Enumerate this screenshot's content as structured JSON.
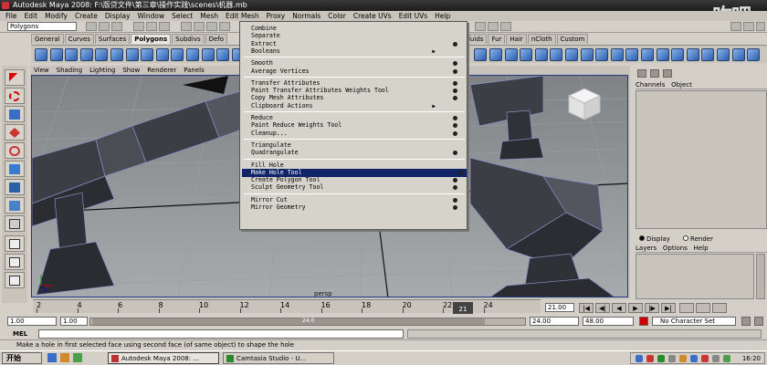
{
  "window": {
    "title": "Autodesk Maya 2008: F:\\版贷文件\\第三章\\操作实践\\scenes\\机器.mb",
    "watermark": "咋吧"
  },
  "menubar": [
    "File",
    "Edit",
    "Modify",
    "Create",
    "Display",
    "Window",
    "Select",
    "Mesh",
    "Edit Mesh",
    "Proxy",
    "Normals",
    "Color",
    "Create UVs",
    "Edit UVs",
    "Help"
  ],
  "status": {
    "mode": "Polygons"
  },
  "shelf_tabs_left": [
    "General",
    "Curves",
    "Surfaces",
    "Polygons",
    "Subdivs",
    "Defo"
  ],
  "shelf_tabs_right": [
    "Fluids",
    "Fur",
    "Hair",
    "nCloth",
    "Custom"
  ],
  "shelf_active": "Polygons",
  "panel_menu": [
    "View",
    "Shading",
    "Lighting",
    "Show",
    "Renderer",
    "Panels"
  ],
  "popup_menu": [
    {
      "label": "Combine",
      "opt": false
    },
    {
      "label": "Separate",
      "opt": false
    },
    {
      "label": "Extract",
      "opt": true
    },
    {
      "label": "Booleans",
      "sub": true
    },
    {
      "sep": true
    },
    {
      "label": "Smooth",
      "opt": true
    },
    {
      "label": "Average Vertices",
      "opt": true
    },
    {
      "sep": true
    },
    {
      "label": "Transfer Attributes",
      "opt": true
    },
    {
      "label": "Paint Transfer Attributes Weights Tool",
      "opt": true
    },
    {
      "label": "Copy Mesh Attributes",
      "opt": true
    },
    {
      "label": "Clipboard Actions",
      "sub": true
    },
    {
      "sep": true
    },
    {
      "label": "Reduce",
      "opt": true
    },
    {
      "label": "Paint Reduce Weights Tool",
      "opt": true
    },
    {
      "label": "Cleanup...",
      "opt": true
    },
    {
      "sep": true
    },
    {
      "label": "Triangulate",
      "opt": false
    },
    {
      "label": "Quadrangulate",
      "opt": true
    },
    {
      "sep": true
    },
    {
      "label": "Fill Hole",
      "opt": false
    },
    {
      "label": "Make Hole Tool",
      "opt": true,
      "hl": true
    },
    {
      "label": "Create Polygon Tool",
      "opt": true
    },
    {
      "label": "Sculpt Geometry Tool",
      "opt": true
    },
    {
      "sep": true
    },
    {
      "label": "Mirror Cut",
      "opt": true
    },
    {
      "label": "Mirror Geometry",
      "opt": true
    }
  ],
  "viewport": {
    "camera": "persp"
  },
  "channel_box": {
    "menu": [
      "Channels",
      "Object"
    ]
  },
  "layer_editor": {
    "display": "Display",
    "render": "Render",
    "menu": [
      "Layers",
      "Options",
      "Help"
    ]
  },
  "timeline": {
    "ticks": [
      "2",
      "4",
      "6",
      "8",
      "10",
      "12",
      "14",
      "16",
      "18",
      "20",
      "22",
      "24"
    ],
    "current": "21",
    "time_field": "21.00"
  },
  "range": {
    "start": "1.00",
    "start2": "1.00",
    "mid": "24.00",
    "end": "24.00",
    "end2": "48.00",
    "slider_label": "24.0",
    "charset": "No Character Set"
  },
  "playback": [
    "|◀",
    "◀|",
    "◀",
    "▶",
    "|▶",
    "▶|"
  ],
  "cmd": {
    "label": "MEL"
  },
  "help_line": "Make a hole in first selected face using second face (of same object) to shape the hole",
  "taskbar": {
    "start": "开始",
    "tasks": [
      {
        "label": "Autodesk Maya 2008: ..."
      },
      {
        "label": "Camtasia Studio - U..."
      }
    ],
    "clock": "16:20"
  }
}
